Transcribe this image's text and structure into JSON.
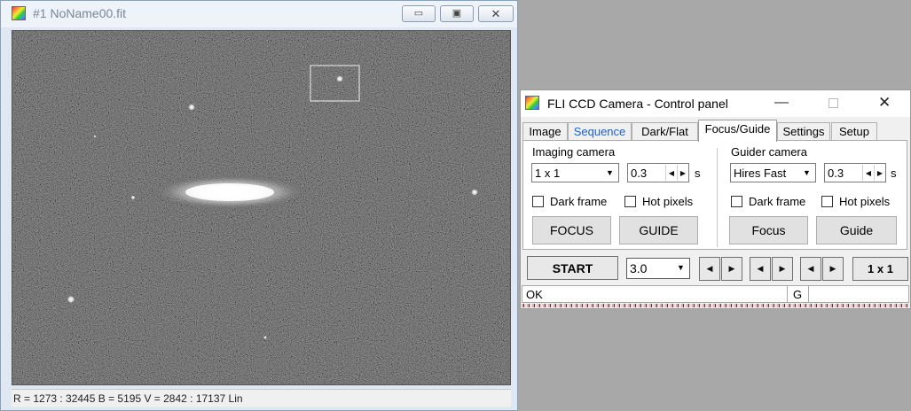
{
  "image_window": {
    "title": "#1 NoName00.fit",
    "minimize_glyph": "▭",
    "restore_glyph": "▣",
    "close_glyph": "✕",
    "status": "R = 1273 : 32445    B = 5195    V = 2842 : 17137 Lin"
  },
  "control_panel": {
    "title": "FLI CCD Camera - Control panel",
    "minimize_glyph": "—",
    "close_glyph": "✕",
    "tabs": [
      "Image",
      "Sequence",
      "Dark/Flat",
      "Focus/Guide",
      "Settings",
      "Setup"
    ],
    "selected_tab": "Focus/Guide",
    "imaging": {
      "label": "Imaging camera",
      "binning": "1 x 1",
      "exposure": "0.3",
      "unit": "s",
      "dark_frame": "Dark frame",
      "hot_pixels": "Hot pixels",
      "focus_button": "FOCUS",
      "guide_button": "GUIDE"
    },
    "guider": {
      "label": "Guider camera",
      "mode": "Hires Fast",
      "exposure": "0.3",
      "unit": "s",
      "dark_frame": "Dark frame",
      "hot_pixels": "Hot pixels",
      "focus_button": "Focus",
      "guide_button": "Guide"
    },
    "bottom": {
      "start_button": "START",
      "value": "3.0",
      "left_arrow": "◀",
      "right_arrow": "▶",
      "binning_button": "1 x 1"
    },
    "status": {
      "message": "OK",
      "indicator": "G"
    }
  },
  "colors": {
    "sequence_tab_text": "#1a63c9",
    "desktop_background": "#a8a8a8"
  }
}
